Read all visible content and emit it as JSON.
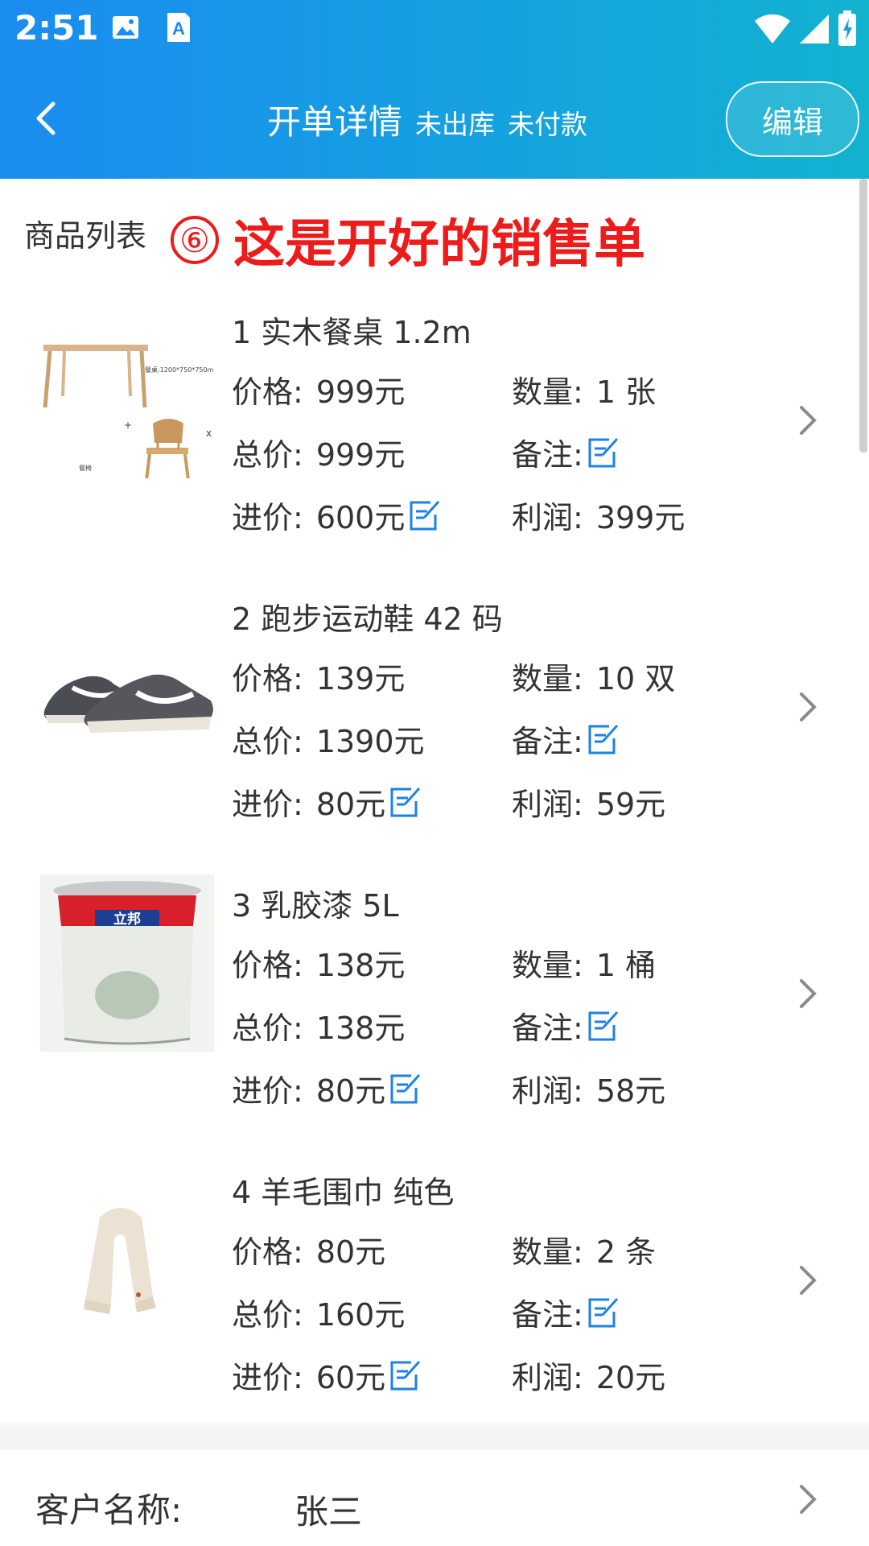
{
  "status_bar": {
    "time": "2:51",
    "icons": [
      "image-icon",
      "font-a-icon",
      "wifi-icon",
      "signal-icon",
      "battery-icon"
    ]
  },
  "titlebar": {
    "title": "开单详情",
    "sub1": "未出库",
    "sub2": "未付款",
    "edit_label": "编辑"
  },
  "list": {
    "label": "商品列表",
    "annotation_number": "⑥",
    "annotation_text": "这是开好的销售单"
  },
  "labels": {
    "price": "价格:",
    "qty": "数量:",
    "total": "总价:",
    "note": "备注:",
    "cost": "进价:",
    "profit": "利润:"
  },
  "products": [
    {
      "name": "1 实木餐桌 1.2m",
      "price": "999元",
      "qty": "1 张",
      "total": "999元",
      "cost": "600元",
      "profit": "399元",
      "image": "dining-table-chair",
      "dim_caption": "餐桌:1200*750*750mm",
      "chair_caption": "餐椅"
    },
    {
      "name": "2 跑步运动鞋 42 码",
      "price": "139元",
      "qty": "10 双",
      "total": "1390元",
      "cost": "80元",
      "profit": "59元",
      "image": "running-shoes"
    },
    {
      "name": "3 乳胶漆 5L",
      "price": "138元",
      "qty": "1 桶",
      "total": "138元",
      "cost": "80元",
      "profit": "58元",
      "image": "paint-bucket",
      "brand": "立邦"
    },
    {
      "name": "4 羊毛围巾 纯色",
      "price": "80元",
      "qty": "2 条",
      "total": "160元",
      "cost": "60元",
      "profit": "20元",
      "image": "wool-scarf"
    }
  ],
  "customer": {
    "label": "客户名称:",
    "value": "张三"
  },
  "colors": {
    "header_start": "#1b8cf0",
    "header_end": "#12b2cf",
    "accent_blue": "#1a82e8",
    "annotation_red": "#ee1b1b"
  }
}
